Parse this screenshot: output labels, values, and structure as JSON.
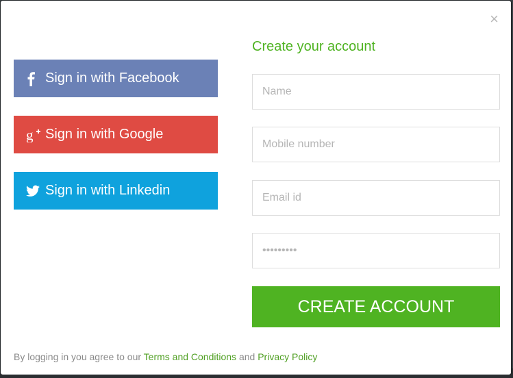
{
  "modal": {
    "close_label": "×",
    "social": {
      "facebook_label": "Sign in with Facebook",
      "facebook_icon": "facebook-icon",
      "google_label": "Sign in with Google",
      "google_icon": "google-plus-icon",
      "linkedin_label": "Sign in with Linkedin",
      "linkedin_icon": "twitter-bird-icon"
    },
    "form": {
      "title": "Create your account",
      "name_placeholder": "Name",
      "mobile_placeholder": "Mobile number",
      "email_placeholder": "Email id",
      "password_placeholder": "•••••••••",
      "submit_label": "CREATE ACCOUNT"
    },
    "footer": {
      "prefix": "By logging in you agree to our ",
      "terms_link": "Terms and Conditions",
      "conjunction": " and ",
      "privacy_link": "Privacy Policy"
    }
  },
  "colors": {
    "facebook": "#6b81b6",
    "google": "#df4b43",
    "linkedin": "#0fa2dd",
    "accent_green": "#4fb322"
  }
}
